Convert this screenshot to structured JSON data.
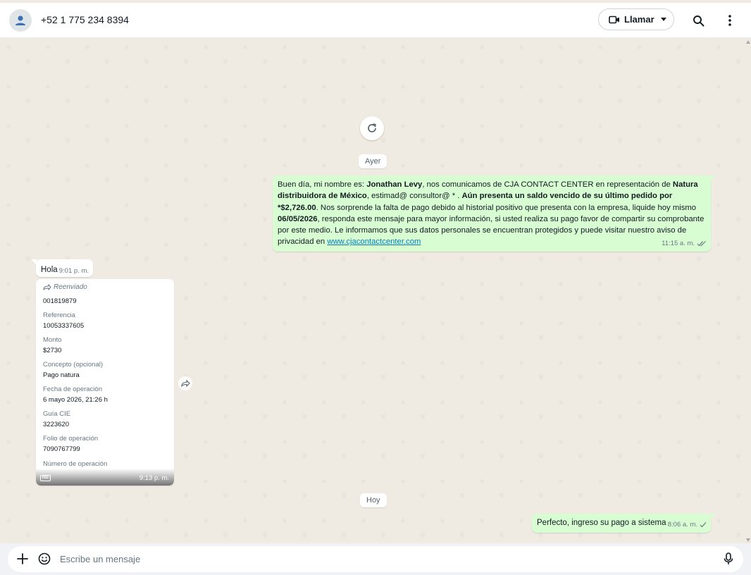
{
  "header": {
    "contact": "+52 1 775 234 8394",
    "call_label": "Llamar"
  },
  "day_separators": [
    "Ayer",
    "Hoy"
  ],
  "messages": {
    "promo": {
      "p1": "Buen día, mi nombre es: ",
      "b1": "Jonathan Levy",
      "p2": ", nos comunicamos de CJA CONTACT CENTER en representación de ",
      "b2": "Natura distribuidora de México",
      "p3": ", estimad@ consultor@ * . ",
      "b3": "Aún presenta un saldo vencido de su último pedido por *$2,726.00",
      "p4": ". Nos sorprende la falta de pago debido al historial positivo que presenta con la empresa, liquide hoy mismo ",
      "b4": "06/05/2026",
      "p5": ", responda este mensaje para mayor información, si usted realiza su pago favor de compartir su comprobante por este medio. Le informamos que sus datos personales se encuentran protegidos y puede visitar nuestro aviso de privacidad en ",
      "link": "www.cjacontactcenter.com",
      "time": "11:15 a. m."
    },
    "hola": {
      "text": "Hola",
      "time": "9:01 p. m."
    },
    "forwarded_card": {
      "label": "Reenviado",
      "top_value": "001819879",
      "fields": [
        {
          "label": "Referencia",
          "value": "10053337605"
        },
        {
          "label": "Monto",
          "value": "$2730"
        },
        {
          "label": "Concepto (opcional)",
          "value": "Pago natura"
        },
        {
          "label": "Fecha de operación",
          "value": "6 mayo 2026, 21:26 h"
        },
        {
          "label": "Guía CIE",
          "value": "3223620"
        },
        {
          "label": "Folio de operación",
          "value": "7090767799"
        },
        {
          "label": "Número de operación",
          "value": ""
        }
      ],
      "badge": "HD",
      "time": "9:13 p. m."
    },
    "reply": {
      "text": "Perfecto, ingreso su pago a sistema",
      "time": "8:06 a. m."
    }
  },
  "composer": {
    "placeholder": "Escribe un mensaje"
  },
  "colors": {
    "outgoing_bubble": "#d9fdd3",
    "incoming_bubble": "#ffffff",
    "chat_background": "#efeae2",
    "read_check": "#667781"
  }
}
